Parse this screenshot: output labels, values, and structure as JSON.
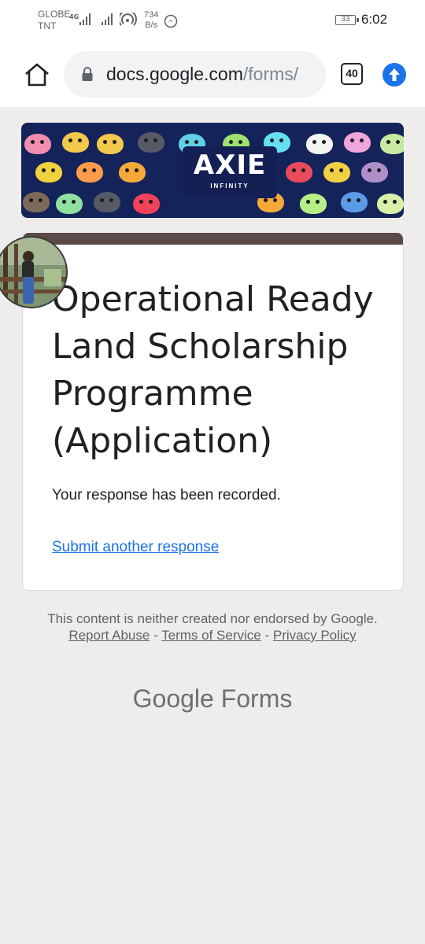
{
  "status_bar": {
    "carrier_line1": "GLOBE",
    "carrier_line2": "TNT",
    "net_type": "4G",
    "speed_value": "734",
    "speed_unit": "B/s",
    "battery": "33",
    "time": "6:02"
  },
  "browser": {
    "url_host": "docs.google.com",
    "url_path": "/forms/",
    "tab_count": "40",
    "colors": {
      "accent": "#1a73e8"
    }
  },
  "banner": {
    "logo_text": "AXIE",
    "logo_sub": "INFINITY"
  },
  "card": {
    "title": "Operational Ready Land Scholarship Programme (Application)",
    "message": "Your response has been recorded.",
    "submit_another": "Submit another response",
    "header_color": "#5b4a47"
  },
  "footer": {
    "disclaimer": "This content is neither created nor endorsed by Google.",
    "report_abuse": "Report Abuse",
    "sep1": " - ",
    "terms": "Terms of Service",
    "sep2": " - ",
    "privacy": "Privacy Policy",
    "brand_google": "Google",
    "brand_forms": "Forms"
  }
}
